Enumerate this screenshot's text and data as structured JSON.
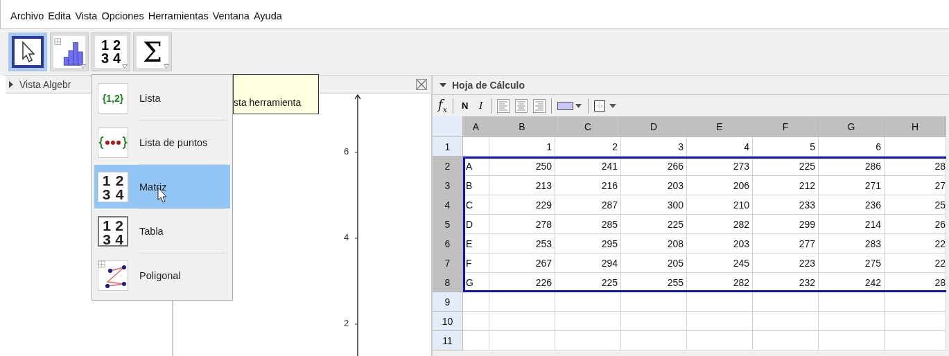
{
  "menu_bar": [
    "Archivo",
    "Edita",
    "Vista",
    "Opciones",
    "Herramientas",
    "Ventana",
    "Ayuda"
  ],
  "toolbar": [
    {
      "kind": "move",
      "selected": true
    },
    {
      "kind": "chart",
      "selected": false
    },
    {
      "kind": "matrix",
      "selected": false,
      "icon_cells": [
        "1",
        "2",
        "3",
        "4"
      ]
    },
    {
      "kind": "sum",
      "selected": false,
      "icon_text": "Σ"
    }
  ],
  "algebra_view": {
    "title": "Vista Algebr"
  },
  "graphics_view": {
    "y_ticks": [
      "6",
      "4",
      "2"
    ]
  },
  "tooltip": {
    "text": "sta herramienta"
  },
  "dropdown": {
    "items": [
      {
        "kind": "list",
        "label": "Lista",
        "selected": false,
        "icon_text": "{1,2}"
      },
      {
        "kind": "point-list",
        "label": "Lista de puntos",
        "selected": false
      },
      {
        "kind": "matrix",
        "label": "Matriz",
        "selected": true,
        "icon_cells": [
          "1",
          "2",
          "3",
          "4"
        ]
      },
      {
        "kind": "table",
        "label": "Tabla",
        "selected": false,
        "icon_cells": [
          "1",
          "2",
          "3",
          "4"
        ]
      },
      {
        "kind": "polyline",
        "label": "Poligonal",
        "selected": false
      }
    ]
  },
  "spreadsheet": {
    "title": "Hoja de Cálculo",
    "formula_label": "*f*$_{x}$",
    "bold_label": "N",
    "italic_label": "I",
    "columns": [
      {
        "label": "A",
        "selected": true
      },
      {
        "label": "B",
        "selected": true
      },
      {
        "label": "C",
        "selected": true
      },
      {
        "label": "D",
        "selected": true
      },
      {
        "label": "E",
        "selected": true
      },
      {
        "label": "F",
        "selected": true
      },
      {
        "label": "G",
        "selected": true
      },
      {
        "label": "H",
        "selected": true
      }
    ],
    "rows": [
      {
        "label": "1",
        "selected": false,
        "values": [
          "1",
          "2",
          "3",
          "4",
          "5",
          "6"
        ]
      },
      {
        "label": "2",
        "selected": true,
        "name": "A",
        "values": [
          "250",
          "241",
          "266",
          "273",
          "225",
          "286",
          "28"
        ]
      },
      {
        "label": "3",
        "selected": true,
        "name": "B",
        "values": [
          "213",
          "216",
          "203",
          "206",
          "212",
          "271",
          "27"
        ]
      },
      {
        "label": "4",
        "selected": true,
        "name": "C",
        "values": [
          "229",
          "287",
          "300",
          "210",
          "233",
          "236",
          "25"
        ]
      },
      {
        "label": "5",
        "selected": true,
        "name": "D",
        "values": [
          "278",
          "285",
          "225",
          "282",
          "299",
          "214",
          "26"
        ]
      },
      {
        "label": "6",
        "selected": true,
        "name": "E",
        "values": [
          "253",
          "295",
          "208",
          "203",
          "277",
          "283",
          "22"
        ]
      },
      {
        "label": "7",
        "selected": true,
        "name": "F",
        "values": [
          "267",
          "294",
          "205",
          "245",
          "223",
          "275",
          "22"
        ]
      },
      {
        "label": "8",
        "selected": true,
        "name": "G",
        "values": [
          "226",
          "225",
          "255",
          "282",
          "232",
          "242",
          "28"
        ]
      },
      {
        "label": "9",
        "selected": false
      },
      {
        "label": "10",
        "selected": false
      },
      {
        "label": "11",
        "selected": false
      }
    ]
  }
}
